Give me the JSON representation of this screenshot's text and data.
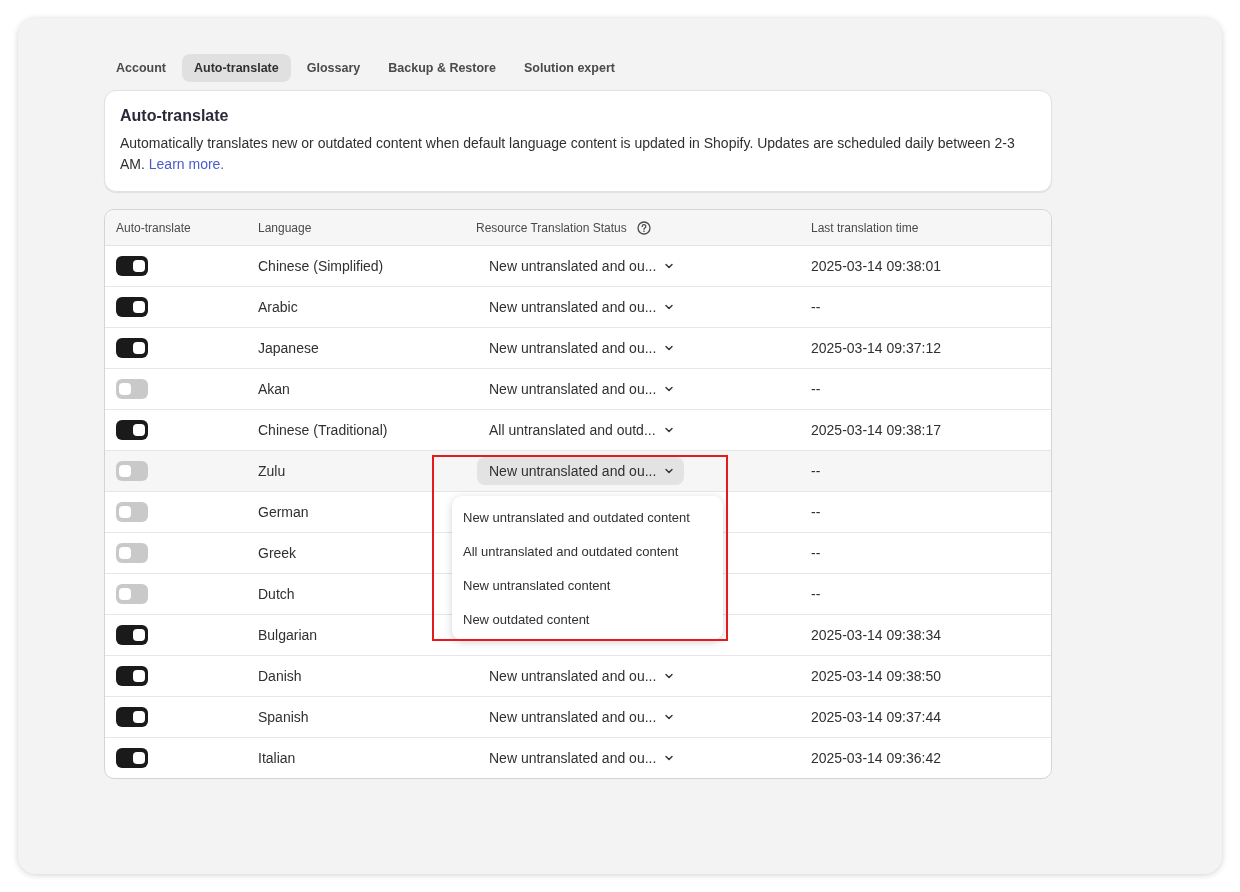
{
  "tabs": [
    {
      "label": "Account",
      "selected": false
    },
    {
      "label": "Auto-translate",
      "selected": true
    },
    {
      "label": "Glossary",
      "selected": false
    },
    {
      "label": "Backup & Restore",
      "selected": false
    },
    {
      "label": "Solution expert",
      "selected": false
    }
  ],
  "info_card": {
    "title": "Auto-translate",
    "description": "Automatically translates new or outdated content when default language content is updated in Shopify. Updates are scheduled daily between 2-3 AM.",
    "link": "Learn more."
  },
  "table": {
    "columns": [
      "Auto-translate",
      "Language",
      "Resource Translation Status",
      "Last translation time"
    ],
    "rows": [
      {
        "on": true,
        "language": "Chinese (Simplified)",
        "status": "New untranslated and ou...",
        "last_time": "2025-03-14 09:38:01",
        "open": false
      },
      {
        "on": true,
        "language": "Arabic",
        "status": "New untranslated and ou...",
        "last_time": "--",
        "open": false
      },
      {
        "on": true,
        "language": "Japanese",
        "status": "New untranslated and ou...",
        "last_time": "2025-03-14 09:37:12",
        "open": false
      },
      {
        "on": false,
        "language": "Akan",
        "status": "New untranslated and ou...",
        "last_time": "--",
        "open": false
      },
      {
        "on": true,
        "language": "Chinese (Traditional)",
        "status": "All untranslated and outd...",
        "last_time": "2025-03-14 09:38:17",
        "open": false
      },
      {
        "on": false,
        "language": "Zulu",
        "status": "New untranslated and ou...",
        "last_time": "--",
        "open": true,
        "highlighted": true
      },
      {
        "on": false,
        "language": "German",
        "last_time": "--"
      },
      {
        "on": false,
        "language": "Greek",
        "last_time": "--"
      },
      {
        "on": false,
        "language": "Dutch",
        "last_time": "--"
      },
      {
        "on": true,
        "language": "Bulgarian",
        "last_time": "2025-03-14 09:38:34"
      },
      {
        "on": true,
        "language": "Danish",
        "status": "New untranslated and ou...",
        "last_time": "2025-03-14 09:38:50",
        "open": false
      },
      {
        "on": true,
        "language": "Spanish",
        "status": "New untranslated and ou...",
        "last_time": "2025-03-14 09:37:44",
        "open": false
      },
      {
        "on": true,
        "language": "Italian",
        "status": "New untranslated and ou...",
        "last_time": "2025-03-14 09:36:42",
        "open": false
      }
    ]
  },
  "status_menu": {
    "options": [
      "New untranslated and outdated content",
      "All untranslated and outdated content",
      "New untranslated content",
      "New outdated content"
    ]
  }
}
